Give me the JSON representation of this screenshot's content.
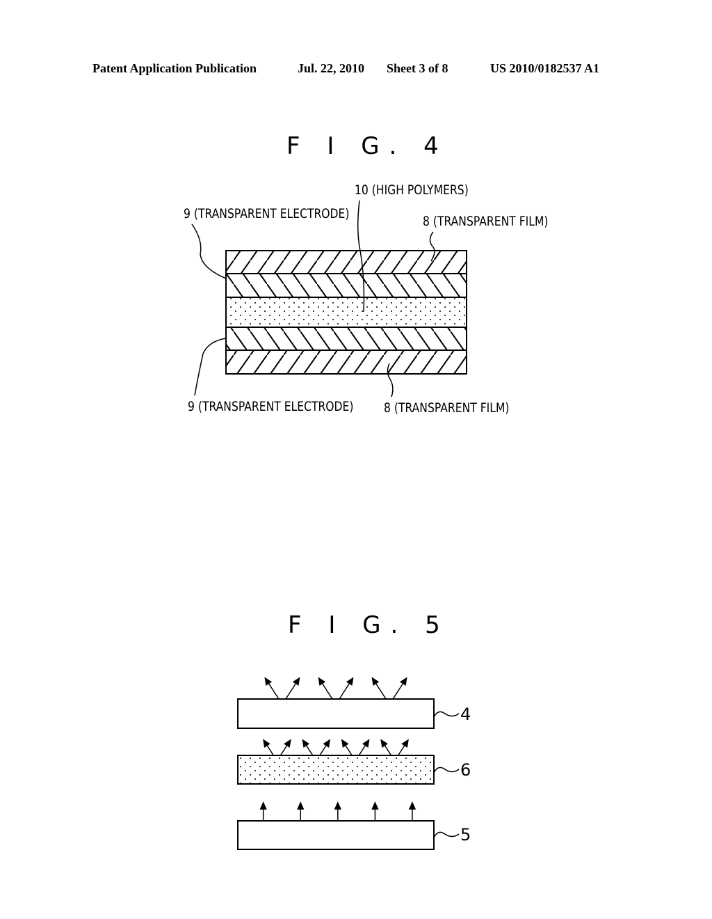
{
  "header": {
    "publication": "Patent Application Publication",
    "date": "Jul. 22, 2010",
    "sheet": "Sheet 3 of 8",
    "number": "US 2010/0182537 A1"
  },
  "figures": [
    {
      "id": "fig4",
      "title": "F I G. 4",
      "layers": [
        {
          "name": "transparent-film",
          "pattern": "hatch-forward"
        },
        {
          "name": "transparent-electrode",
          "pattern": "hatch-backward"
        },
        {
          "name": "high-polymers",
          "pattern": "dots"
        },
        {
          "name": "transparent-electrode",
          "pattern": "hatch-backward"
        },
        {
          "name": "transparent-film",
          "pattern": "hatch-forward"
        }
      ],
      "labels": {
        "top_polymer": "10 (HIGH POLYMERS)",
        "top_electrode": "9 (TRANSPARENT ELECTRODE)",
        "top_film": "8 (TRANSPARENT FILM)",
        "bottom_electrode": "9 (TRANSPARENT ELECTRODE)",
        "bottom_film": "8 (TRANSPARENT FILM)"
      }
    },
    {
      "id": "fig5",
      "title": "F I G. 5",
      "plates": [
        {
          "ref": "4",
          "fill": "plain",
          "arrows": "diagonal-pairs",
          "arrow_count": 6
        },
        {
          "ref": "6",
          "fill": "dots",
          "arrows": "diagonal-pairs",
          "arrow_count": 8
        },
        {
          "ref": "5",
          "fill": "plain",
          "arrows": "vertical",
          "arrow_count": 5
        }
      ]
    }
  ]
}
